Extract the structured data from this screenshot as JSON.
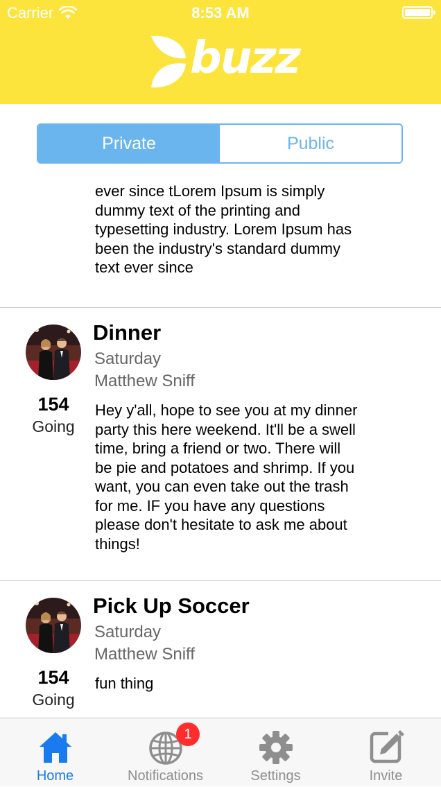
{
  "status_bar": {
    "carrier": "Carrier",
    "time": "8:53 AM"
  },
  "header": {
    "logo_text": "buzz"
  },
  "segmented_control": {
    "private_label": "Private",
    "public_label": "Public",
    "selected": "Private"
  },
  "feed": {
    "partial_item_text": "ever since tLorem Ipsum is simply dummy text of the printing and typesetting industry. Lorem Ipsum has been the industry's standard dummy text ever since",
    "events": [
      {
        "title": "Dinner",
        "day": "Saturday",
        "host": "Matthew Sniff",
        "going_count": "154",
        "going_label": "Going",
        "description": "Hey y'all, hope to see you at my dinner party this here weekend. It'll be a swell time, bring a friend or two. There will be pie and potatoes and shrimp. If you want, you can even take out the trash for me. IF you have any questions please don't hesitate to ask me about things!"
      },
      {
        "title": "Pick Up Soccer",
        "day": "Saturday",
        "host": "Matthew Sniff",
        "going_count": "154",
        "going_label": "Going",
        "description": "fun thing"
      }
    ]
  },
  "tabbar": {
    "tabs": [
      {
        "label": "Home",
        "icon": "home-icon",
        "active": true
      },
      {
        "label": "Notifications",
        "icon": "globe-icon",
        "badge": "1"
      },
      {
        "label": "Settings",
        "icon": "gear-icon"
      },
      {
        "label": "Invite",
        "icon": "edit-icon"
      }
    ]
  },
  "colors": {
    "header_yellow": "#fde43c",
    "segment_blue": "#6ab5ee",
    "tab_active_blue": "#1a7bf0",
    "badge_red": "#ff2d2d"
  }
}
